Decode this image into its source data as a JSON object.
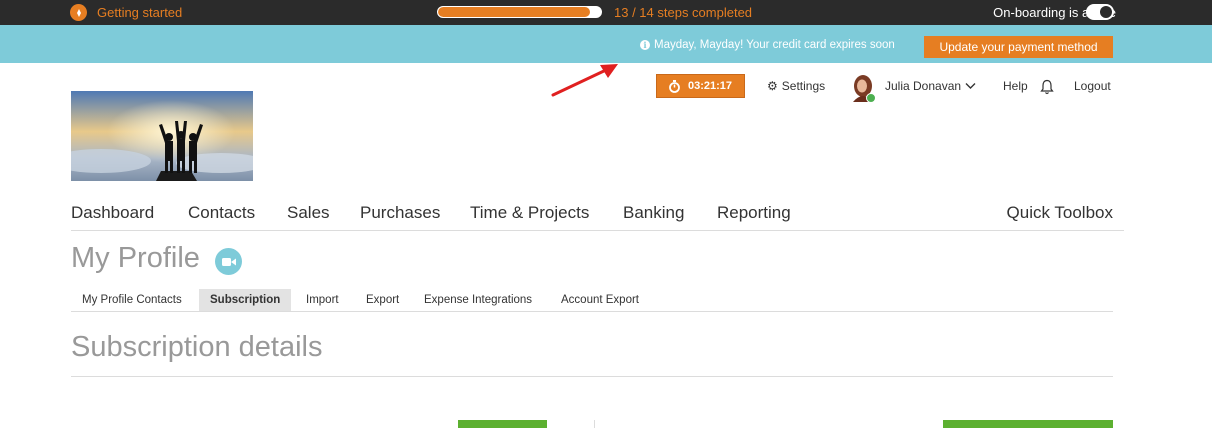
{
  "onboarding": {
    "title": "Getting started",
    "steps_text": "13 / 14 steps completed",
    "progress": 0.93,
    "active_text": "On-boarding is active",
    "active": true
  },
  "alert": {
    "message": "Mayday, Mayday! Your credit card expires soon",
    "button": "Update your payment method"
  },
  "header": {
    "timer": "03:21:17",
    "settings": "Settings",
    "user": "Julia Donavan",
    "help": "Help",
    "logout": "Logout"
  },
  "nav": {
    "items": [
      "Dashboard",
      "Contacts",
      "Sales",
      "Purchases",
      "Time & Projects",
      "Banking",
      "Reporting"
    ],
    "toolbox": "Quick Toolbox"
  },
  "page": {
    "title": "My Profile",
    "subnav": [
      "My Profile Contacts",
      "Subscription",
      "Import",
      "Export",
      "Expense Integrations",
      "Account Export"
    ],
    "active_subnav": "Subscription",
    "section_title": "Subscription details"
  },
  "colors": {
    "accent": "#e67e22",
    "alert_bg": "#7ecbd9",
    "dark_bar": "#2b2b2b",
    "green": "#5cb030"
  }
}
